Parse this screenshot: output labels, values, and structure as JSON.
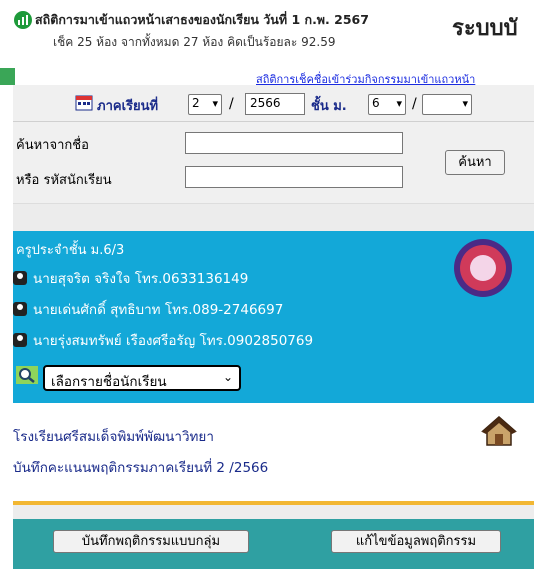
{
  "header": {
    "stats_title": "สถิติการมาเข้าแถวหน้าเสาธงของนักเรียน วันที่ 1 ก.พ. 2567",
    "stats_sub": "เช็ค 25 ห้อง จากทั้งหมด 27 ห้อง คิดเป็นร้อยละ 92.59",
    "system_title": "ระบบบั",
    "marquee": "สถิติการเช็คชื่อเข้าร่วมกิจกรรมมาเข้าแถวหน้า"
  },
  "term": {
    "label": "ภาคเรียนที่",
    "term_value": "2",
    "year_value": "2566",
    "grade_label": "ชั้น ม.",
    "grade_value": "6",
    "room_value": ""
  },
  "search": {
    "name_label": "ค้นหาจากชื่อ",
    "id_label": "หรือ รหัสนักเรียน",
    "name_value": "",
    "id_value": "",
    "button_label": "ค้นหา"
  },
  "teachers": {
    "heading": "ครูประจำชั้น ม.6/3",
    "list": [
      "นายสุจริต จริงใจ โทร.0633136149",
      "นายเด่นศักดิ์ สุทธิบาท โทร.089-2746697",
      "นายรุ่งสมทรัพย์ เรืองศรีอรัญ โทร.0902850769"
    ],
    "student_select": "เลือกรายชื่อนักเรียน"
  },
  "school": {
    "name": "โรงเรียนศรีสมเด็จพิมพ์พัฒนาวิทยา",
    "record_title": "บันทึกคะแนนพฤติกรรมภาคเรียนที่ 2 /2566"
  },
  "actions": {
    "group_button": "บันทึกพฤติกรรมแบบกลุ่ม",
    "edit_button": "แก้ไขข้อมูลพฤติกรรม"
  },
  "colors": {
    "teacher_panel": "#13a8d8",
    "bottom_bar": "#2fa0a2",
    "accent_line": "#f2b733",
    "link_blue": "#1a2b8a"
  }
}
